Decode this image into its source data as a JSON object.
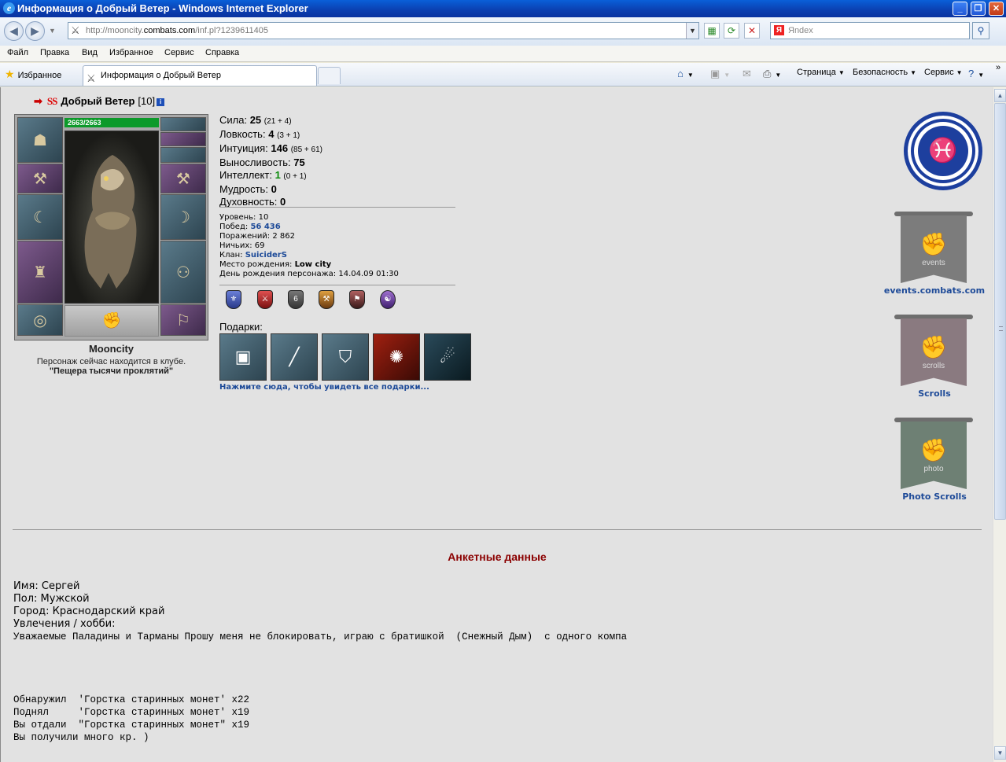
{
  "window": {
    "title": "Информация о Добрый Ветер - Windows Internet Explorer",
    "url_prefix": "http://mooncity.",
    "url_domain": "combats.com",
    "url_path": "/inf.pl?1239611405",
    "search_placeholder": "Яndex"
  },
  "menu": [
    "Файл",
    "Правка",
    "Вид",
    "Избранное",
    "Сервис",
    "Справка"
  ],
  "toolbar": {
    "favorites": "Избранное",
    "tab_title": "Информация о Добрый Ветер",
    "page": "Страница",
    "security": "Безопасность",
    "tools": "Сервис"
  },
  "character": {
    "name": "Добрый Ветер",
    "level": "[10]",
    "hp": "2663/2663",
    "city": "Mooncity",
    "location_text": "Персонаж сейчас находится в клубе.",
    "location_place": "\"Пещера тысячи проклятий\""
  },
  "stats": [
    {
      "label": "Сила:",
      "value": "25",
      "detail": "(21 + 4)"
    },
    {
      "label": "Ловкость:",
      "value": "4",
      "detail": "(3 + 1)"
    },
    {
      "label": "Интуиция:",
      "value": "146",
      "detail": "(85 + 61)"
    },
    {
      "label": "Выносливость:",
      "value": "75",
      "detail": ""
    },
    {
      "label": "Интеллект:",
      "value": "1",
      "detail": "(0 + 1)"
    },
    {
      "label": "Мудрость:",
      "value": "0",
      "detail": ""
    },
    {
      "label": "Духовность:",
      "value": "0",
      "detail": ""
    }
  ],
  "info": {
    "level": "Уровень: 10",
    "wins_label": "Побед:",
    "wins": "56 436",
    "losses": "Поражений: 2 862",
    "draws": "Ничьих: 69",
    "clan_label": "Клан:",
    "clan": "SuiciderS",
    "birthplace_label": "Место рождения:",
    "birthplace": "Low city",
    "birthday": "День рождения персонажа: 14.04.09 01:30"
  },
  "gifts": {
    "label": "Подарки:",
    "link": "Нажмите сюда, чтобы увидеть все подарки..."
  },
  "banners": {
    "events_word": "events",
    "events_label": "events.combats.com",
    "scrolls_word": "scrolls",
    "scrolls_label": "Scrolls",
    "photo_word": "photo",
    "photo_label": "Photo Scrolls"
  },
  "profile": {
    "heading": "Анкетные данные",
    "name": "Имя: Сергей",
    "gender": "Пол: Мужской",
    "city": "Город: Краснодарский край",
    "hobby": "Увлечения / хобби:",
    "hobby_text": "Уважаемые Паладины и Тарманы Прошу меня не блокировать, играю с братишкой  (Снежный Дым)  с одного компа",
    "log": [
      "Обнаружил  'Горстка старинных монет' x22",
      "Поднял     'Горстка старинных монет' x19",
      "Вы отдали  \"Горстка старинных монет\" x19",
      "Вы получили много кр. )"
    ]
  }
}
